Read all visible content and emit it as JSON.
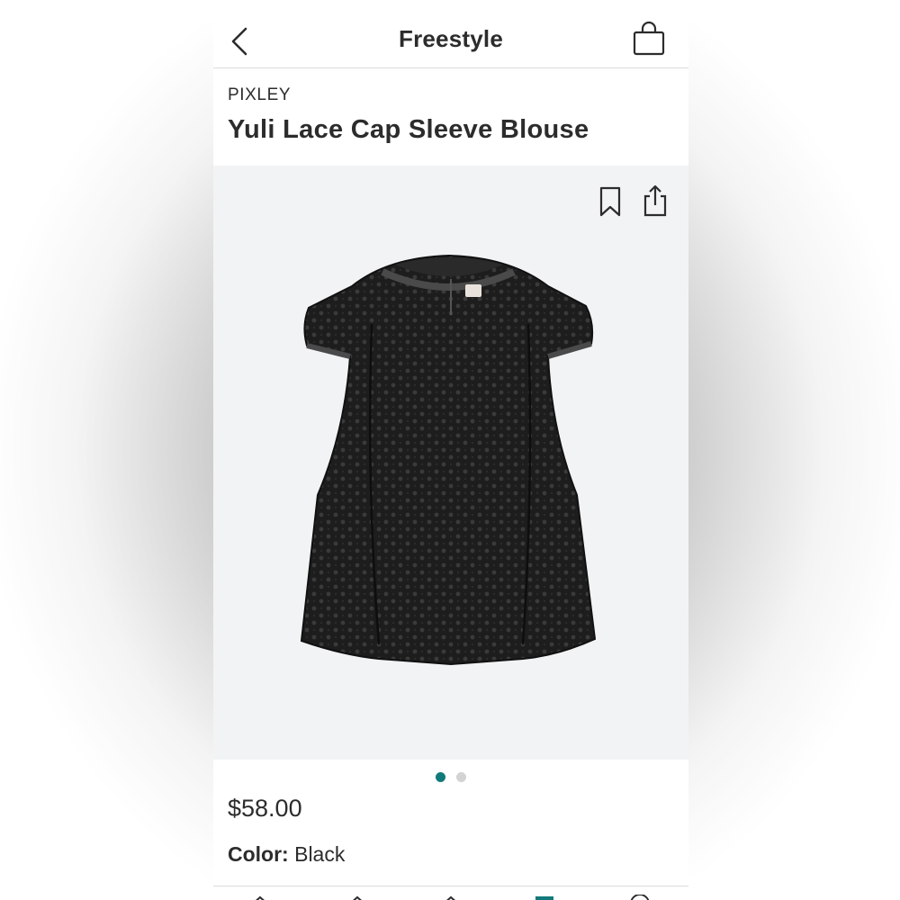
{
  "header": {
    "title": "Freestyle",
    "back_icon": "chevron-left-icon",
    "bag_icon": "shopping-bag-icon"
  },
  "product": {
    "brand": "PIXLEY",
    "name": "Yuli Lace Cap Sleeve Blouse",
    "price": "$58.00",
    "color_label": "Color:",
    "color_value": "Black",
    "image_subject": "black eyelet lace cap sleeve blouse"
  },
  "image_actions": {
    "bookmark_icon": "bookmark-icon",
    "share_icon": "share-icon"
  },
  "carousel": {
    "total": 2,
    "active_index": 0,
    "active_color": "#127a7a",
    "inactive_color": "#d3d3d3"
  },
  "tab_bar": {
    "items": [
      {
        "icon": "home-icon",
        "active": false
      },
      {
        "icon": "box-icon",
        "active": false
      },
      {
        "icon": "style-icon",
        "active": false
      },
      {
        "icon": "freestyle-icon",
        "active": true
      },
      {
        "icon": "account-icon",
        "active": false
      }
    ],
    "active_color": "#127a7a"
  },
  "colors": {
    "text": "#2c2c2c",
    "image_background": "#f2f3f5",
    "accent": "#127a7a"
  }
}
